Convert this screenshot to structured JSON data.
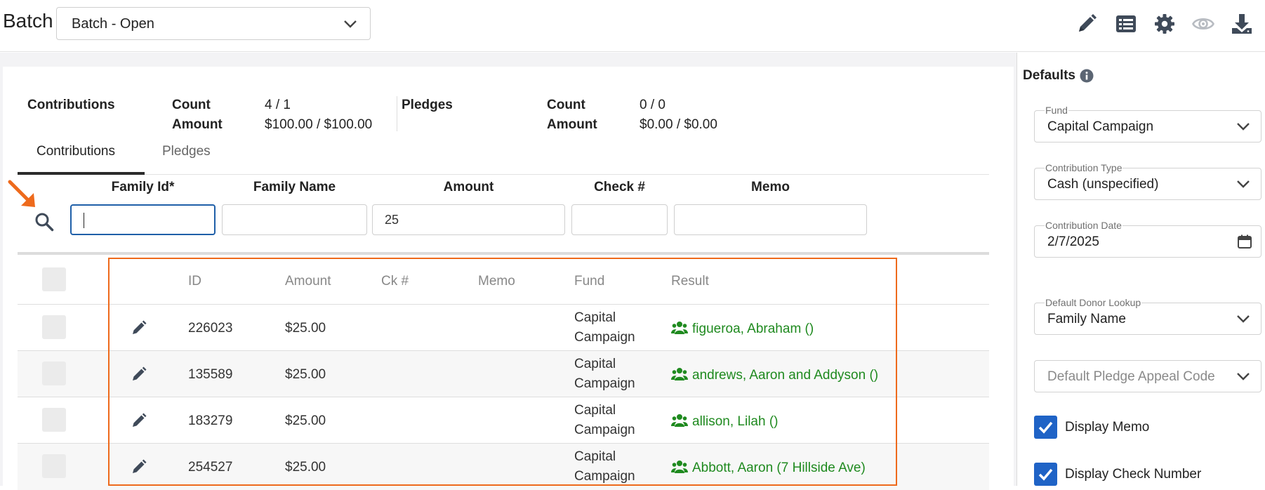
{
  "header": {
    "title": "Batch",
    "batch_select_value": "Batch - Open",
    "icons": [
      "pencil-icon",
      "list-icon",
      "gear-icon",
      "eye-icon",
      "download-icon"
    ]
  },
  "summary": {
    "contributions_label": "Contributions",
    "pledges_label": "Pledges",
    "count_label": "Count",
    "amount_label": "Amount",
    "contrib_count": "4 / 1",
    "contrib_amount": "$100.00 / $100.00",
    "pledge_count": "0 / 0",
    "pledge_amount": "$0.00 / $0.00"
  },
  "tabs": [
    {
      "label": "Contributions",
      "active": true
    },
    {
      "label": "Pledges",
      "active": false
    }
  ],
  "entry": {
    "labels": {
      "family_id": "Family Id*",
      "family_name": "Family Name",
      "amount": "Amount",
      "check": "Check #",
      "memo": "Memo"
    },
    "values": {
      "family_id": "",
      "family_name": "",
      "amount": "25",
      "check": "",
      "memo": ""
    }
  },
  "table": {
    "headers": {
      "id": "ID",
      "amount": "Amount",
      "ck": "Ck #",
      "memo": "Memo",
      "fund": "Fund",
      "result": "Result"
    },
    "rows": [
      {
        "id": "226023",
        "amount": "$25.00",
        "ck": "",
        "memo": "",
        "fund_line1": "Capital",
        "fund_line2": "Campaign",
        "result": "figueroa, Abraham ()"
      },
      {
        "id": "135589",
        "amount": "$25.00",
        "ck": "",
        "memo": "",
        "fund_line1": "Capital",
        "fund_line2": "Campaign",
        "result": "andrews, Aaron and Addyson ()"
      },
      {
        "id": "183279",
        "amount": "$25.00",
        "ck": "",
        "memo": "",
        "fund_line1": "Capital",
        "fund_line2": "Campaign",
        "result": "allison, Lilah ()"
      },
      {
        "id": "254527",
        "amount": "$25.00",
        "ck": "",
        "memo": "",
        "fund_line1": "Capital",
        "fund_line2": "Campaign",
        "result": "Abbott, Aaron (7 Hillside Ave)"
      }
    ]
  },
  "sidebar": {
    "title": "Defaults",
    "fund": {
      "label": "Fund",
      "value": "Capital Campaign"
    },
    "contribution_type": {
      "label": "Contribution Type",
      "value": "Cash (unspecified)"
    },
    "contribution_date": {
      "label": "Contribution Date",
      "value": "2/7/2025"
    },
    "donor_lookup": {
      "label": "Default Donor Lookup",
      "value": "Family Name"
    },
    "pledge_appeal": {
      "placeholder": "Default Pledge Appeal Code"
    },
    "display_memo": {
      "label": "Display Memo",
      "checked": true
    },
    "display_check": {
      "label": "Display Check Number",
      "checked": true
    }
  },
  "colors": {
    "accent_blue": "#1f63c6",
    "result_green": "#1f8a1f",
    "highlight_orange": "#ee6a1c"
  }
}
